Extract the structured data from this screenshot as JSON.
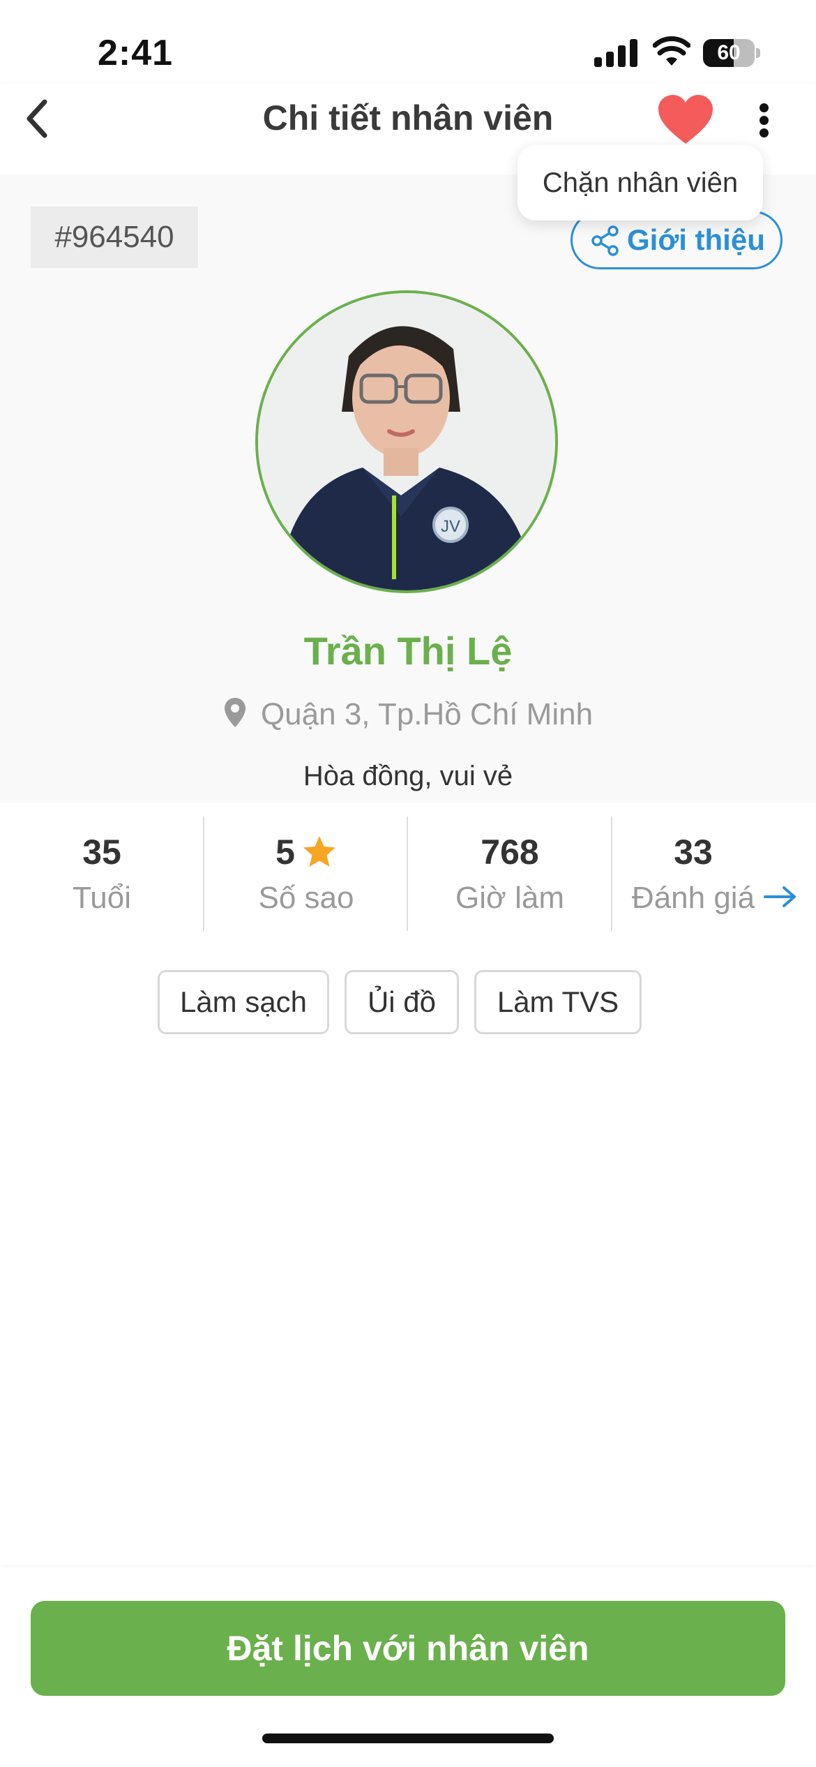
{
  "status_bar": {
    "time": "2:41",
    "battery": "60",
    "battery_level": 0.6
  },
  "header": {
    "title": "Chi tiết nhân viên",
    "back_icon": "chevron-left-icon",
    "favorite_icon": "heart-icon",
    "more_icon": "more-vertical-icon",
    "favorite_color": "#f45b5b"
  },
  "dropdown": {
    "items": [
      {
        "label": "Chặn nhân viên"
      }
    ]
  },
  "profile": {
    "employee_id": "#964540",
    "intro_label": "Giới thiệu",
    "intro_icon": "share-icon",
    "avatar_icon": "employee-photo",
    "name": "Trần Thị Lệ",
    "location": "Quận 3, Tp.Hồ Chí Minh",
    "location_icon": "map-pin-icon",
    "bio": "Hòa đồng, vui vẻ"
  },
  "stats": [
    {
      "value": "35",
      "label": "Tuổi"
    },
    {
      "value": "5",
      "label": "Số sao",
      "icon": "star-icon"
    },
    {
      "value": "768",
      "label": "Giờ làm"
    },
    {
      "value": "33",
      "label": "Đánh giá",
      "icon": "arrow-right-icon"
    }
  ],
  "skills": [
    {
      "label": "Làm sạch"
    },
    {
      "label": "Ủi đồ"
    },
    {
      "label": "Làm TVS"
    }
  ],
  "footer": {
    "book_label": "Đặt lịch với nhân viên"
  },
  "colors": {
    "primary_green": "#6ab04c",
    "accent_blue": "#2a90d6",
    "star": "#f5a623"
  }
}
